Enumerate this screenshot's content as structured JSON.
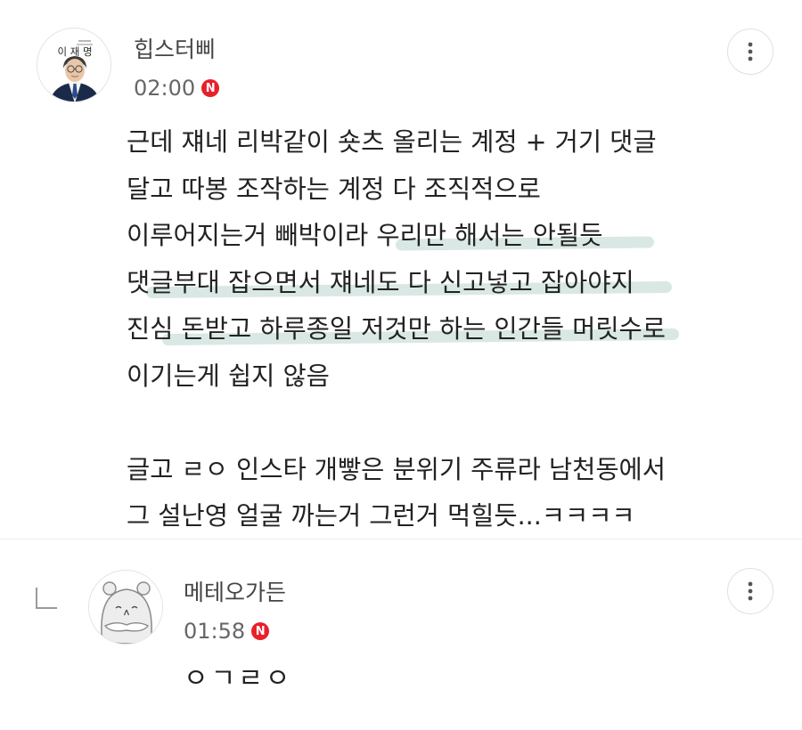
{
  "comments": [
    {
      "username": "힙스터삐",
      "time": "02:00",
      "badge": "N",
      "avatar_icon": "politician-portrait-icon",
      "avatar_caption": "이 재 명",
      "lines": [
        "근데 쟤네 리박같이 숏츠 올리는 계정 + 거기 댓글",
        "달고 따봉 조작하는 계정 다 조직적으로",
        "이루어지는거 빼박이라 ",
        "우리만 해서는 안될듯",
        "댓글부대 잡으면서 쟤네도 다 신고넣고 잡아야지",
        "진심 돈받고 하루종일 저것만 하는 인간들 머릿수로",
        "이기는게 쉽지 않음",
        "글고 ㄹㅇ 인스타 개빻은 분위기 주류라 남천동에서",
        "그 설난영 얼굴 까는거 그런거 먹힐듯...ㅋㅋㅋㅋ"
      ]
    },
    {
      "username": "메테오가든",
      "time": "01:58",
      "badge": "N",
      "avatar_icon": "character-face-icon",
      "text": "ㅇㄱㄹㅇ"
    }
  ],
  "icons": {
    "more": "more-vertical-icon",
    "reply": "reply-arrow-icon"
  },
  "colors": {
    "badge": "#e8202a",
    "highlight": "#d2e4e0"
  }
}
